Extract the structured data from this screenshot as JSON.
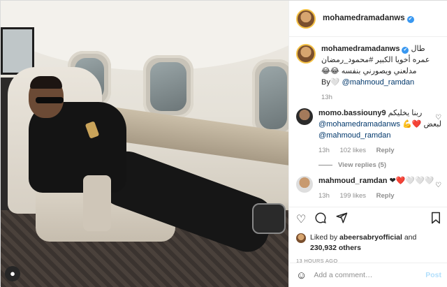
{
  "account": {
    "username": "mohamedramadanws",
    "verified_glyph": "✔"
  },
  "caption": {
    "username": "mohamedramadanws",
    "text": "طال عمره أخويا الكبير #محمود_رمضان مدلعني ويصورني بنفسه 😂😂",
    "by_prefix": "By🤍",
    "by_mention": "@mahmoud_ramdan",
    "age": "13h"
  },
  "comments": [
    {
      "username": "momo.bassiouny9",
      "text_ar": "ربنا يخليكم",
      "mention1": "@mohamedramadanws",
      "text_ar2": "لبعض ❤️💪",
      "mention2": "@mahmoud_ramdan",
      "age": "13h",
      "likes": "102 likes",
      "reply": "Reply",
      "view_replies": "View replies (5)"
    },
    {
      "username": "mahmoud_ramdan",
      "text": "❤❤️🤍🤍🤍",
      "age": "13h",
      "likes": "199 likes",
      "reply": "Reply"
    }
  ],
  "actions": {
    "like_icon": "heart-outline",
    "comment_icon": "comment-bubble",
    "share_icon": "paper-plane",
    "save_icon": "bookmark"
  },
  "likes": {
    "prefix": "Liked by",
    "user": "abeersabryofficial",
    "and": "and",
    "count": "230,932 others"
  },
  "timestamp": "13 HOURS AGO",
  "add_comment": {
    "placeholder": "Add a comment…",
    "post_label": "Post"
  },
  "colors": {
    "verified_blue": "#3897f0",
    "link_blue": "#00376b",
    "post_disabled": "#b2dffc",
    "muted": "#8e8e8e"
  }
}
